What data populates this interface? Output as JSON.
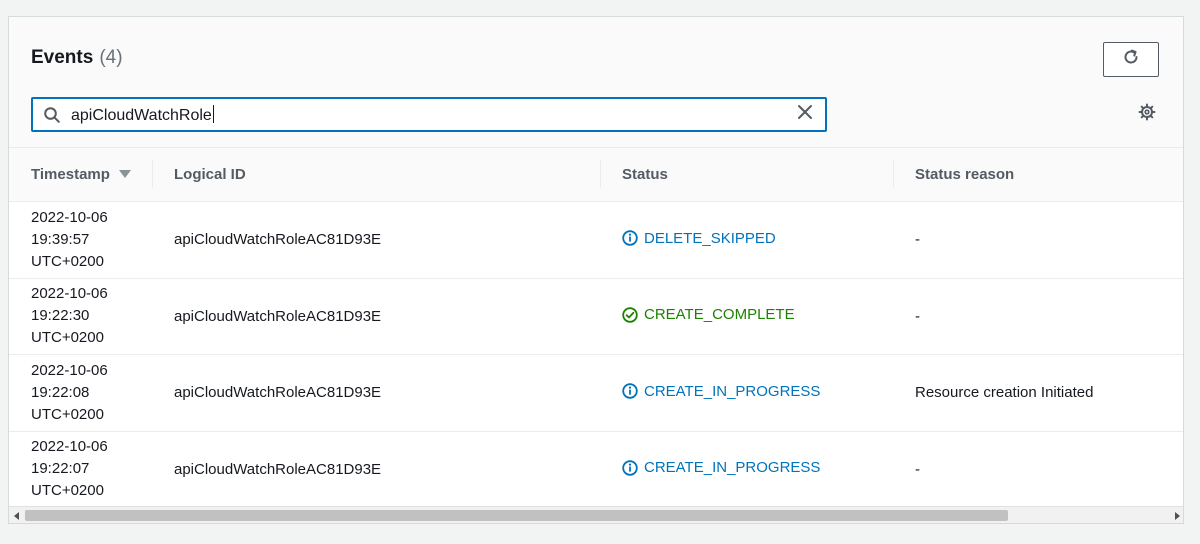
{
  "events": {
    "title": "Events",
    "count": "(4)"
  },
  "toolbar": {
    "refresh_icon": "refresh-icon",
    "settings_icon": "gear-icon"
  },
  "search": {
    "value": "apiCloudWatchRole",
    "icon": "search-icon",
    "clear_icon": "close-icon"
  },
  "table": {
    "columns": [
      "Timestamp",
      "Logical ID",
      "Status",
      "Status reason"
    ],
    "sorted_column": "Timestamp",
    "rows": [
      {
        "timestamp": [
          "2022-10-06",
          "19:39:57",
          "UTC+0200"
        ],
        "logical_id": "apiCloudWatchRoleAC81D93E",
        "status": "DELETE_SKIPPED",
        "status_type": "info",
        "reason": "-"
      },
      {
        "timestamp": [
          "2022-10-06",
          "19:22:30",
          "UTC+0200"
        ],
        "logical_id": "apiCloudWatchRoleAC81D93E",
        "status": "CREATE_COMPLETE",
        "status_type": "success",
        "reason": "-"
      },
      {
        "timestamp": [
          "2022-10-06",
          "19:22:08",
          "UTC+0200"
        ],
        "logical_id": "apiCloudWatchRoleAC81D93E",
        "status": "CREATE_IN_PROGRESS",
        "status_type": "info",
        "reason": "Resource creation Initiated"
      },
      {
        "timestamp": [
          "2022-10-06",
          "19:22:07",
          "UTC+0200"
        ],
        "logical_id": "apiCloudWatchRoleAC81D93E",
        "status": "CREATE_IN_PROGRESS",
        "status_type": "info",
        "reason": "-"
      }
    ]
  },
  "colors": {
    "info": "#0073bb",
    "success": "#1d8102",
    "header_text": "#545b64"
  }
}
